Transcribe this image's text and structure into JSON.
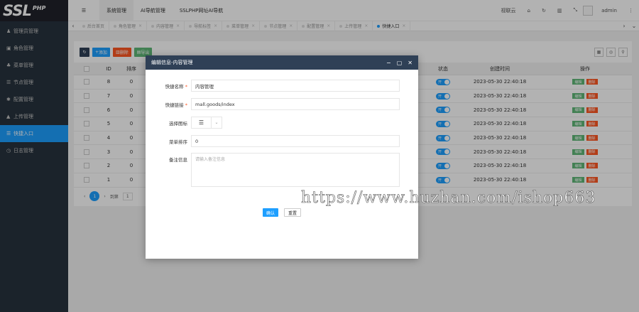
{
  "logo": {
    "main": "SSL",
    "sub": "PHP"
  },
  "sidebar": {
    "items": [
      {
        "label": "管理员管理",
        "icon": "user-icon"
      },
      {
        "label": "角色管理",
        "icon": "id-card-icon"
      },
      {
        "label": "菜单管理",
        "icon": "menu-tree-icon"
      },
      {
        "label": "节点管理",
        "icon": "list-icon"
      },
      {
        "label": "配置管理",
        "icon": "gear-icon"
      },
      {
        "label": "上传管理",
        "icon": "upload-icon"
      },
      {
        "label": "快捷入口",
        "icon": "bars-icon"
      },
      {
        "label": "日志管理",
        "icon": "clock-icon"
      }
    ],
    "active_index": 6
  },
  "header": {
    "menu_toggle": "☰",
    "tabs": [
      "系统管理",
      "AI导航管理",
      "SSLPHP网址AI导航"
    ],
    "right": {
      "clear_cache": "视联云",
      "username": "admin"
    }
  },
  "page_tabs": [
    "后台首页",
    "角色管理",
    "内容管理",
    "导航标签",
    "菜单管理",
    "节点管理",
    "配置管理",
    "上传管理",
    "快捷入口"
  ],
  "toolbar": {
    "add": "添加",
    "delete": "删除",
    "export": "导出"
  },
  "table": {
    "headers": {
      "id": "ID",
      "sort": "排序",
      "status": "状态",
      "created": "创建时间",
      "ops": "操作"
    },
    "rows": [
      {
        "id": "8",
        "sort": "0",
        "status": "开",
        "created": "2023-05-30 22:40:18"
      },
      {
        "id": "7",
        "sort": "0",
        "status": "开",
        "created": "2023-05-30 22:40:18"
      },
      {
        "id": "6",
        "sort": "0",
        "status": "开",
        "created": "2023-05-30 22:40:18"
      },
      {
        "id": "5",
        "sort": "0",
        "status": "开",
        "created": "2023-05-30 22:40:18"
      },
      {
        "id": "4",
        "sort": "0",
        "status": "开",
        "created": "2023-05-30 22:40:18"
      },
      {
        "id": "3",
        "sort": "0",
        "status": "开",
        "created": "2023-05-30 22:40:18"
      },
      {
        "id": "2",
        "sort": "0",
        "status": "开",
        "created": "2023-05-30 22:40:18"
      },
      {
        "id": "1",
        "sort": "0",
        "status": "开",
        "created": "2023-05-30 22:40:18"
      }
    ],
    "op_edit": "编辑",
    "op_delete": "删除"
  },
  "pager": {
    "current": "1",
    "goto_label": "到第",
    "goto_value": "1"
  },
  "modal": {
    "title": "编辑信息-内容管理",
    "fields": {
      "name_label": "快捷名称",
      "name_value": "内容管理",
      "link_label": "快捷链接",
      "link_value": "mall.goods/index",
      "icon_label": "选择图标",
      "icon_value": "☰",
      "sort_label": "菜单排序",
      "sort_value": "0",
      "remark_label": "备注信息",
      "remark_placeholder": "请输入备注信息"
    },
    "confirm": "确认",
    "reset": "重置"
  },
  "watermark": "https://www.huzhan.com/ishop663"
}
